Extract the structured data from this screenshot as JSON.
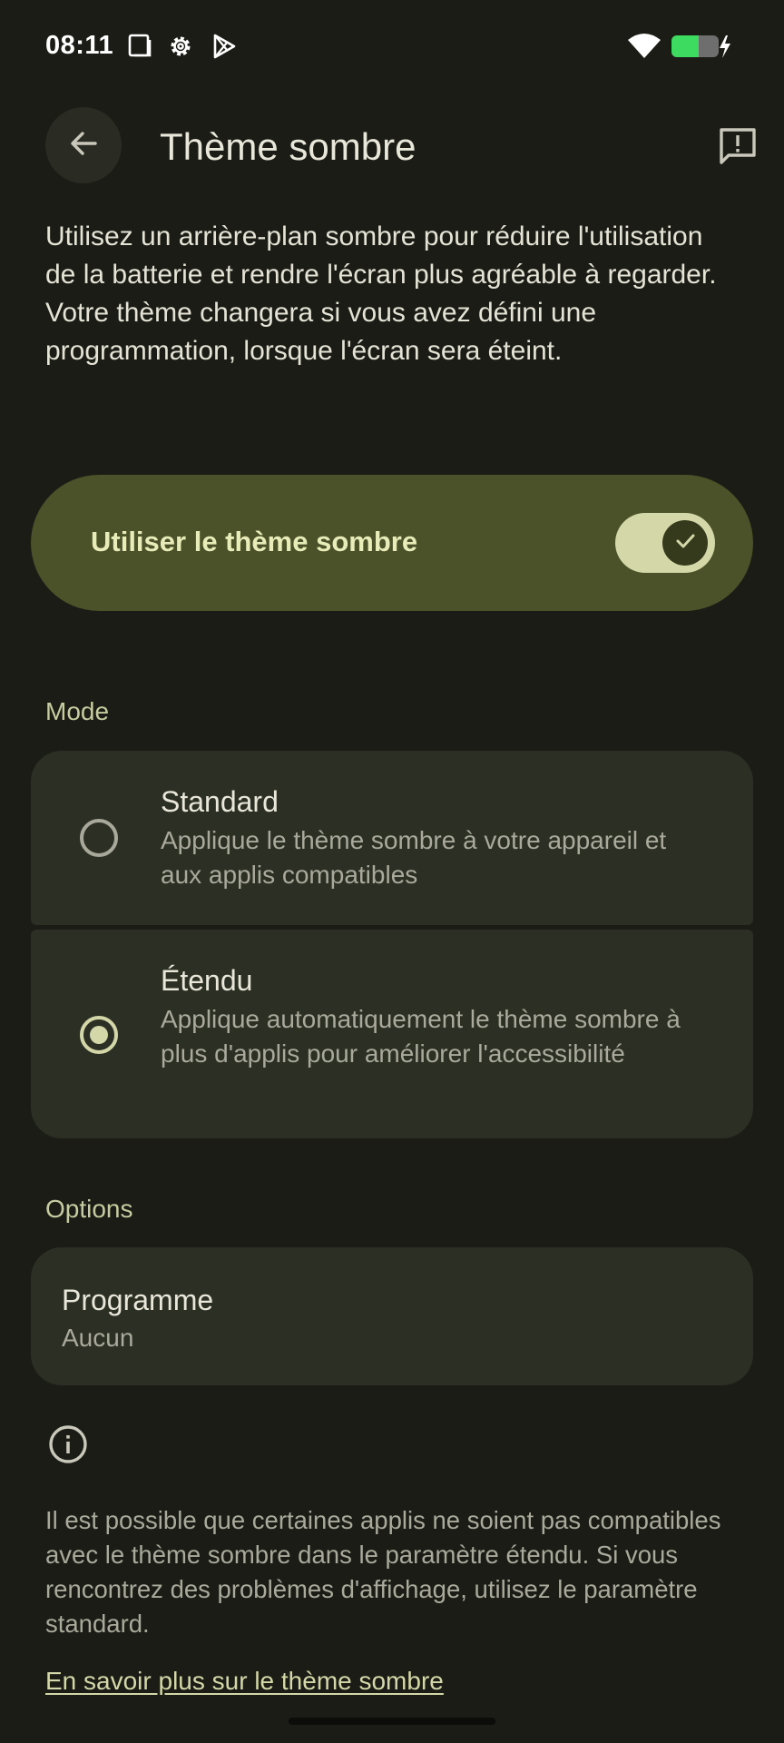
{
  "status_bar": {
    "time": "08:11",
    "icons": [
      "screenshot-icon",
      "settings-gear-icon",
      "play-store-icon",
      "wifi-icon",
      "battery-charging-icon"
    ],
    "battery_color": "#3ddc60"
  },
  "header": {
    "title": "Thème sombre",
    "back_icon": "arrow-back-icon",
    "feedback_icon": "feedback-icon"
  },
  "description": "Utilisez un arrière-plan sombre pour réduire l'utilisation de la batterie et rendre l'écran plus agréable à regarder. Votre thème changera si vous avez défini une programmation, lorsque l'écran sera éteint.",
  "main_toggle": {
    "label": "Utiliser le thème sombre",
    "checked": true,
    "accent": "#4b5128"
  },
  "mode_section": {
    "header": "Mode",
    "options": [
      {
        "title": "Standard",
        "subtitle": "Applique le thème sombre à votre appareil et aux applis compatibles",
        "selected": false
      },
      {
        "title": "Étendu",
        "subtitle": "Applique automatiquement le thème sombre à plus d'applis pour améliorer l'accessibilité",
        "selected": true
      }
    ]
  },
  "options_section": {
    "header": "Options",
    "schedule": {
      "title": "Programme",
      "value": "Aucun"
    }
  },
  "footer": {
    "info_icon": "info-icon",
    "text": "Il est possible que certaines applis ne soient pas compatibles avec le thème sombre dans le paramètre étendu. Si vous rencontrez des problèmes d'affichage, utilisez le paramètre standard.",
    "link": "En savoir plus sur le thème sombre"
  }
}
